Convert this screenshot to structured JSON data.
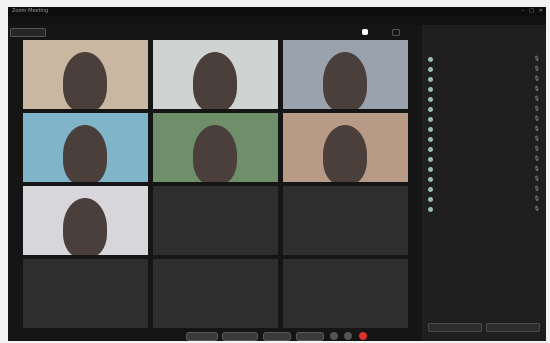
{
  "window": {
    "title": "Zoom Meeting",
    "menu_text": "",
    "controls": [
      "–",
      "□",
      "✕"
    ]
  },
  "meeting_pill": "",
  "view_buttons": [
    "",
    ""
  ],
  "tiles": [
    {
      "label": "",
      "bg": "#c9b7a2",
      "photo": true
    },
    {
      "label": "",
      "bg": "#cfd3d1",
      "photo": true
    },
    {
      "label": "",
      "bg": "#9aa3ad",
      "photo": true
    },
    {
      "label": "",
      "bg": "#7fb4c9",
      "photo": true
    },
    {
      "label": "",
      "bg": "#6f8f6a",
      "photo": true
    },
    {
      "label": "",
      "bg": "#b79b86",
      "photo": true
    },
    {
      "label": "",
      "bg": "#d7d7db",
      "photo": true
    },
    {
      "label": "",
      "bg": "#2e2e2e",
      "photo": false
    },
    {
      "label": "",
      "bg": "#2e2e2e",
      "photo": false
    },
    {
      "label": "",
      "bg": "#2e2e2e",
      "photo": false
    },
    {
      "label": "",
      "bg": "#2e2e2e",
      "photo": false
    },
    {
      "label": "",
      "bg": "#2e2e2e",
      "photo": false
    }
  ],
  "controls": {
    "buttons": [
      "",
      "",
      "",
      ""
    ]
  },
  "panel": {
    "title": "",
    "subtitle": "",
    "participants": [
      "",
      "",
      "",
      "",
      "",
      "",
      "",
      "",
      "",
      "",
      "",
      "",
      "",
      "",
      "",
      ""
    ],
    "footer_buttons": [
      "",
      ""
    ]
  },
  "colors": {
    "window_bg": "#151515",
    "tile_bg": "#2e2e2e",
    "panel_bg": "#1f1f1f",
    "end_red": "#e0302a"
  }
}
